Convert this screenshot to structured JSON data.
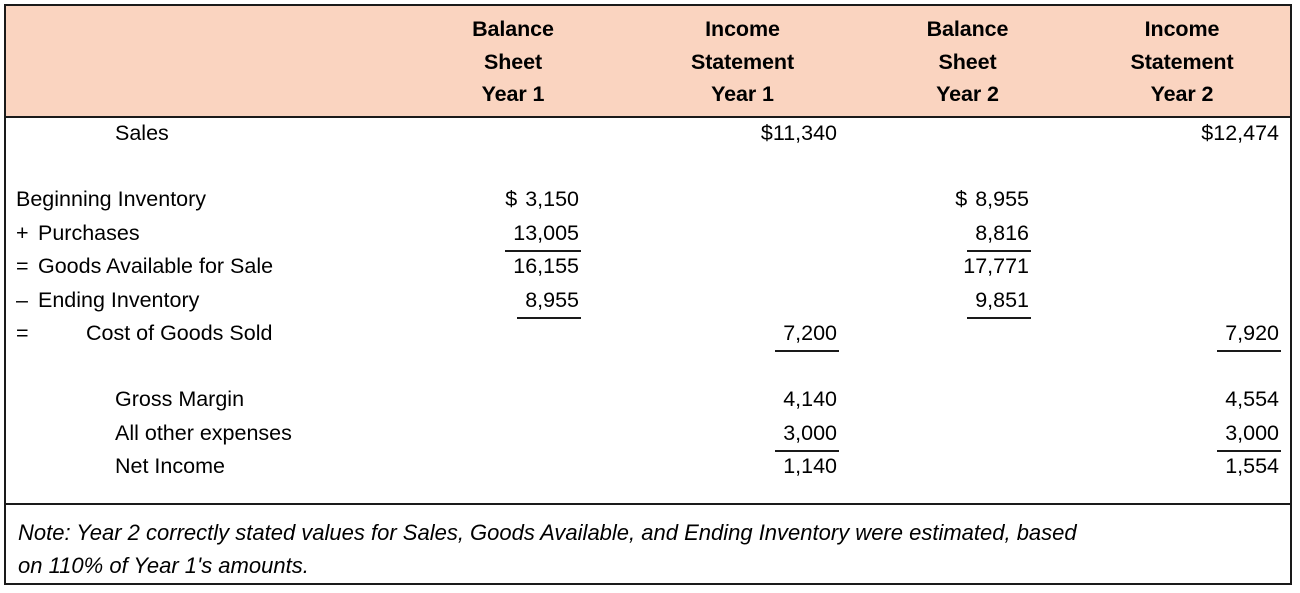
{
  "table": {
    "columns": [
      {
        "key": "label",
        "lines": []
      },
      {
        "key": "bs1",
        "lines": [
          "Balance",
          "Sheet",
          "Year 1"
        ]
      },
      {
        "key": "is1",
        "lines": [
          "Income",
          "Statement",
          "Year 1"
        ]
      },
      {
        "key": "bs2",
        "lines": [
          "Balance",
          "Sheet",
          "Year 2"
        ]
      },
      {
        "key": "is2",
        "lines": [
          "Income",
          "Statement",
          "Year 2"
        ]
      }
    ],
    "header": {
      "bs1_l1": "Balance",
      "bs1_l2": "Sheet",
      "bs1_l3": "Year 1",
      "is1_l1": "Income",
      "is1_l2": "Statement",
      "is1_l3": "Year 1",
      "bs2_l1": "Balance",
      "bs2_l2": "Sheet",
      "bs2_l3": "Year 2",
      "is2_l1": "Income",
      "is2_l2": "Statement",
      "is2_l3": "Year 2"
    },
    "rows": {
      "sales": {
        "label": "Sales",
        "bs1": "",
        "is1": "$11,340",
        "bs2": "",
        "is2": "$12,474"
      },
      "beginning_inventory": {
        "op": "",
        "label": "Beginning Inventory",
        "bs1_dollar": "$",
        "bs1": "3,150",
        "is1": "",
        "bs2_dollar": "$",
        "bs2": "8,955",
        "is2": ""
      },
      "purchases": {
        "op": "+",
        "label": "Purchases",
        "bs1": "13,005",
        "is1": "",
        "bs2": "8,816",
        "is2": ""
      },
      "goods_available": {
        "op": "=",
        "label": "Goods Available for Sale",
        "bs1": "16,155",
        "is1": "",
        "bs2": "17,771",
        "is2": ""
      },
      "ending_inventory": {
        "op": "–",
        "label": "Ending Inventory",
        "bs1": "8,955",
        "is1": "",
        "bs2": "9,851",
        "is2": ""
      },
      "cost_of_goods_sold": {
        "op": "=",
        "label": "Cost of Goods Sold",
        "bs1": "",
        "is1": "7,200",
        "bs2": "",
        "is2": "7,920"
      },
      "gross_margin": {
        "label": "Gross Margin",
        "bs1": "",
        "is1": "4,140",
        "bs2": "",
        "is2": "4,554"
      },
      "all_other_expenses": {
        "label": "All other expenses",
        "bs1": "",
        "is1": "3,000",
        "bs2": "",
        "is2": "3,000"
      },
      "net_income": {
        "label": "Net Income",
        "bs1": "",
        "is1": "1,140",
        "bs2": "",
        "is2": "1,554"
      }
    }
  },
  "footnote": {
    "line1": "Note: Year 2 correctly stated values for Sales, Goods Available, and Ending Inventory were estimated, based",
    "line2": "on 110% of Year 1's amounts."
  },
  "colors": {
    "header_background": "#FAD4C0",
    "border": "#1A1A1A",
    "text": "#000000",
    "page_background": "#FFFFFF"
  }
}
